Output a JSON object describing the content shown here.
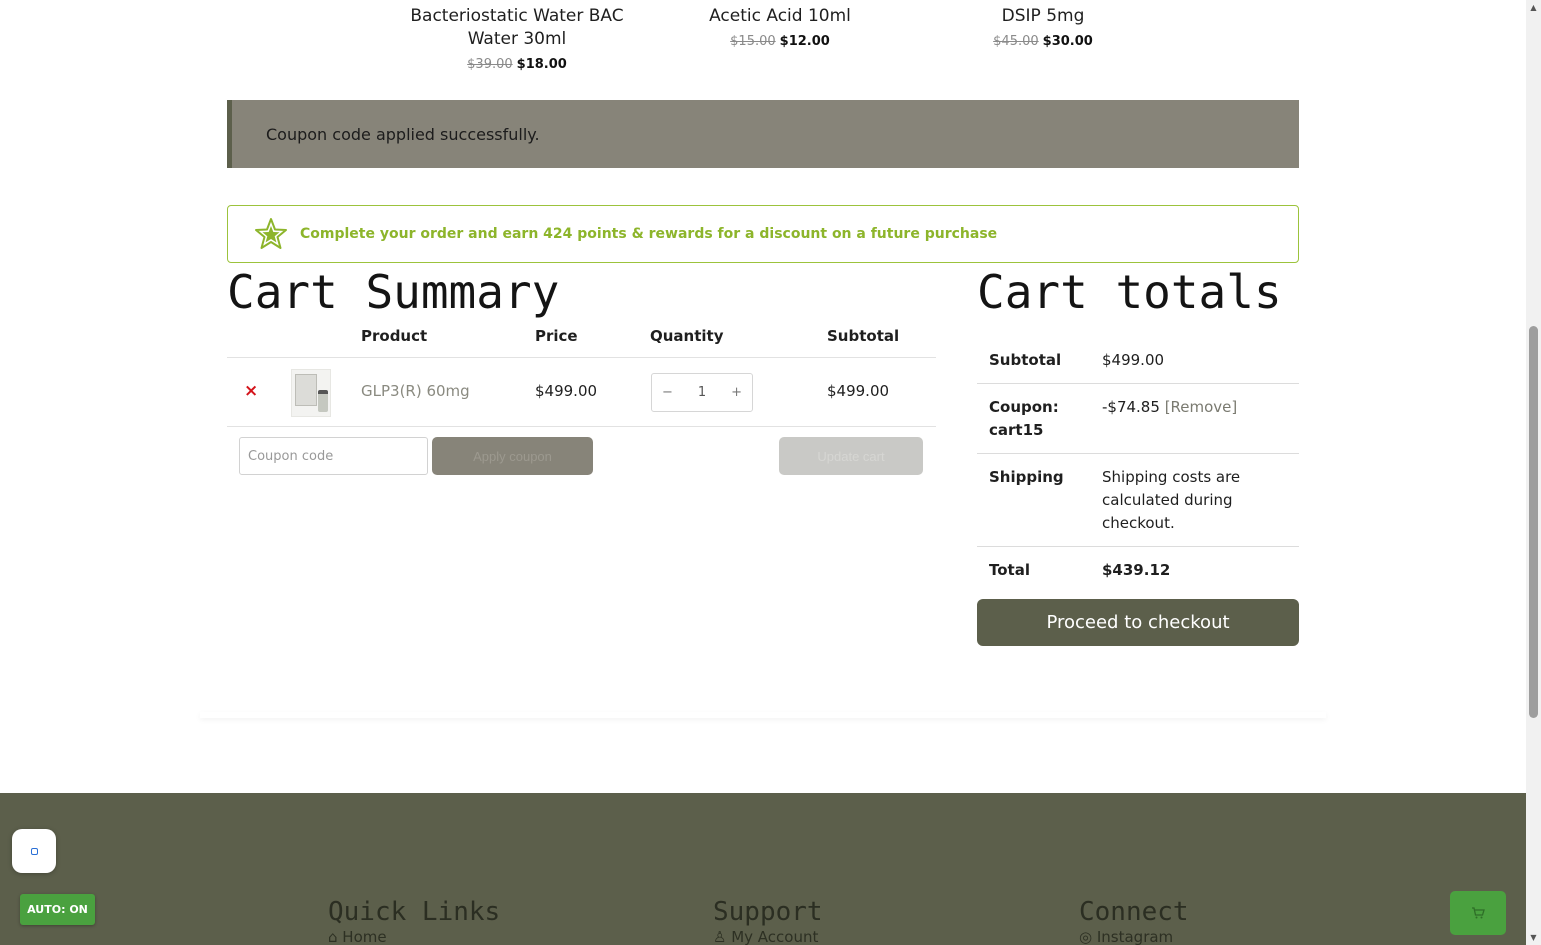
{
  "related": [
    {
      "name": "Bacteriostatic Water BAC Water 30ml",
      "old_price": "$39.00",
      "new_price": "$18.00"
    },
    {
      "name": "Acetic Acid 10ml",
      "old_price": "$15.00",
      "new_price": "$12.00"
    },
    {
      "name": "DSIP 5mg",
      "old_price": "$45.00",
      "new_price": "$30.00"
    }
  ],
  "notice": "Coupon code applied successfully.",
  "points_banner": "Complete your order and earn 424 points & rewards for a discount on a future purchase",
  "cart_summary": {
    "title": "Cart Summary",
    "headers": {
      "product": "Product",
      "price": "Price",
      "quantity": "Quantity",
      "subtotal": "Subtotal"
    },
    "items": [
      {
        "remove": "×",
        "name": "GLP3(R) 60mg",
        "price": "$499.00",
        "qty_minus": "−",
        "qty": "1",
        "qty_plus": "+",
        "subtotal": "$499.00"
      }
    ],
    "coupon_placeholder": "Coupon code",
    "apply_label": "Apply coupon",
    "update_label": "Update cart"
  },
  "cart_totals": {
    "title": "Cart totals",
    "subtotal_label": "Subtotal",
    "subtotal_value": "$499.00",
    "coupon_label": "Coupon: cart15",
    "coupon_value": "-$74.85",
    "coupon_remove": "[Remove]",
    "shipping_label": "Shipping",
    "shipping_value": "Shipping costs are calculated during checkout.",
    "total_label": "Total",
    "total_value": "$439.12",
    "checkout_label": "Proceed to checkout"
  },
  "footer": {
    "quick_links": {
      "title": "Quick Links",
      "first": "⌂ Home"
    },
    "support": {
      "title": "Support",
      "first": "♙ My Account"
    },
    "connect": {
      "title": "Connect",
      "first": "◎ Instagram"
    }
  },
  "widgets": {
    "auto_label": "AUTO: ON",
    "cart_icon": "cart-icon"
  },
  "colors": {
    "brand_dark": "#5c5f4b",
    "notice_bg": "#878479",
    "points_green": "#8db52b",
    "remove_red": "#d4141b",
    "widget_green": "#4aa13f"
  }
}
